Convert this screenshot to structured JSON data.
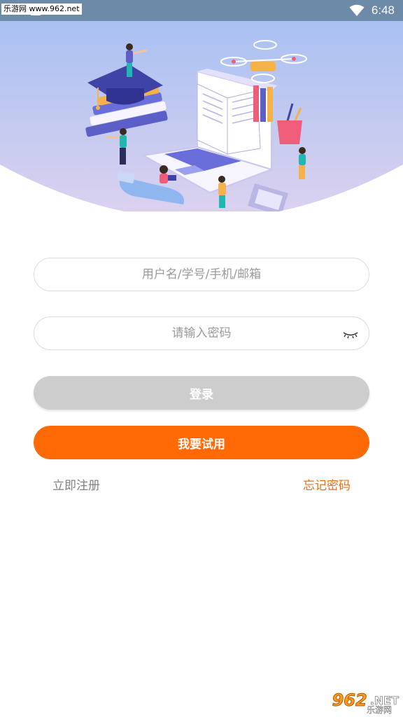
{
  "status_bar": {
    "watermark": "乐游网 www.962.net",
    "time": "6:48",
    "wifi_icon": "wifi-icon"
  },
  "hero": {
    "illustration": "education-laptop-illustration",
    "background_top": "#a9c1f2",
    "background_bottom": "#d8cdee"
  },
  "login_form": {
    "username_placeholder": "用户名/学号/手机/邮箱",
    "username_value": "",
    "password_placeholder": "请输入密码",
    "password_value": "",
    "password_toggle_icon": "eye-closed-icon",
    "login_label": "登录",
    "trial_label": "我要试用",
    "register_label": "立即注册",
    "forgot_label": "忘记密码"
  },
  "colors": {
    "accent": "#ff6a06",
    "login_disabled": "#cdcdcd",
    "forgot_link": "#ee6d16",
    "register_link": "#808080"
  },
  "watermark_bottom": {
    "number": "962",
    "suffix": ".NET",
    "text": "乐游网"
  }
}
